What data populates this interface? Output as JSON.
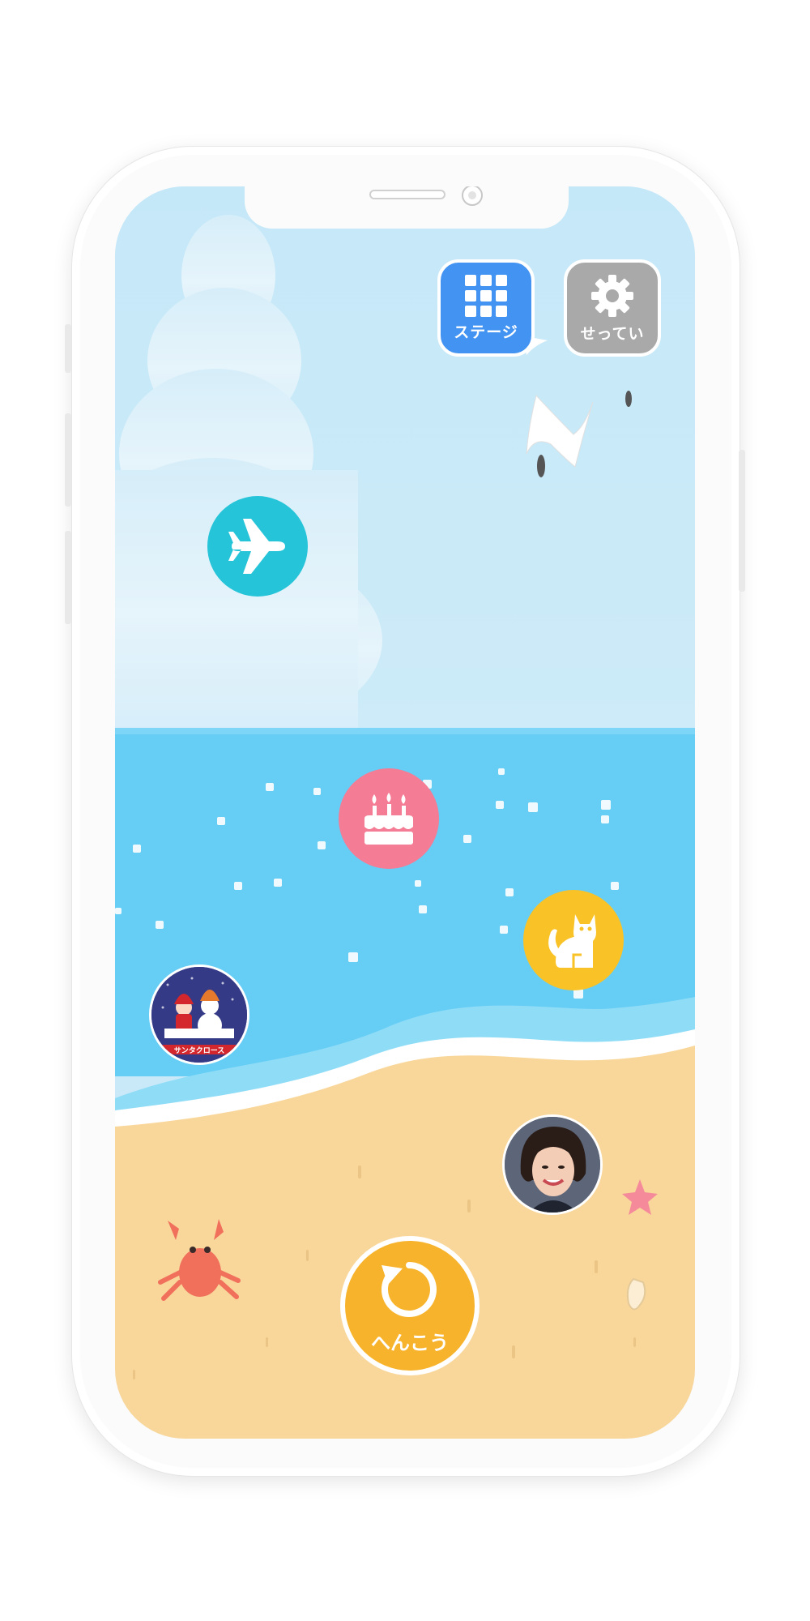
{
  "header": {
    "stage_label": "ステージ",
    "settings_label": "せってい"
  },
  "icons": {
    "stage": "grid-icon",
    "settings": "gear-icon",
    "airplane": "airplane-icon",
    "cake": "birthday-cake-icon",
    "cat": "cat-icon",
    "reset": "rotate-icon"
  },
  "thumbnail": {
    "caption": "サンタクロース"
  },
  "reset": {
    "label": "へんこう"
  },
  "colors": {
    "stage_button": "#4394f2",
    "settings_button": "#a9a9a9",
    "airplane": "#26c4d8",
    "cake": "#f47c95",
    "cat": "#f9c226",
    "reset": "#f7b32b",
    "sky": "#c9e9f8",
    "sea": "#66cdf5",
    "sand": "#f9d79b"
  }
}
